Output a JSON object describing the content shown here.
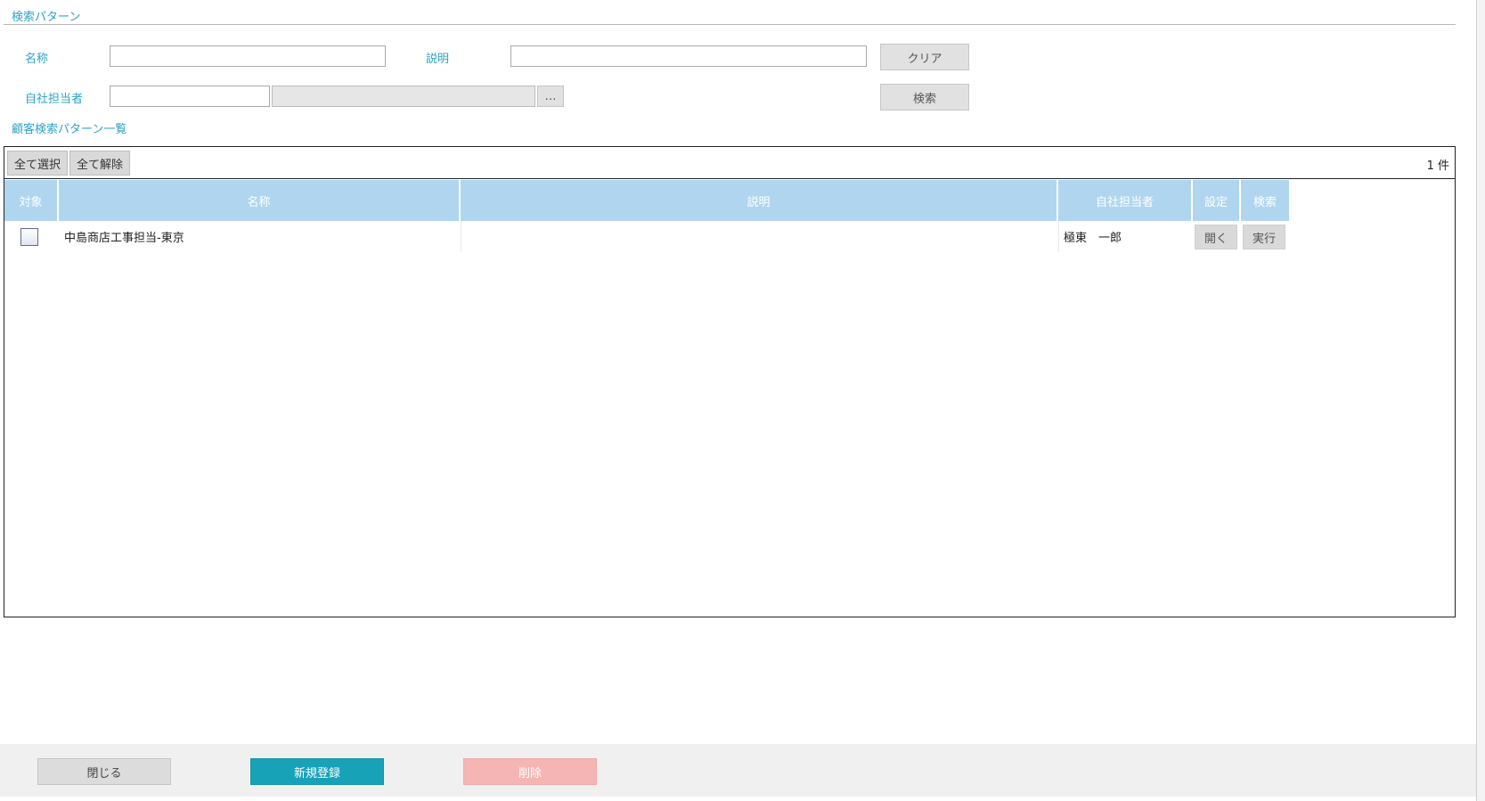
{
  "search_section": {
    "title": "検索パターン",
    "name_label": "名称",
    "name_value": "",
    "description_label": "説明",
    "description_value": "",
    "clear_button": "クリア",
    "owner_label": "自社担当者",
    "owner_code_value": "",
    "owner_name_value": "",
    "owner_picker_button": "…",
    "search_button": "検索"
  },
  "list_section": {
    "title": "顧客検索パターン一覧",
    "select_all_button": "全て選択",
    "deselect_all_button": "全て解除",
    "count_text": "1 件",
    "columns": [
      "対象",
      "名称",
      "説明",
      "自社担当者",
      "設定",
      "検索"
    ],
    "rows": [
      {
        "checked": false,
        "name": "中島商店工事担当-東京",
        "description": "",
        "owner": "極東　一郎",
        "open_button": "開く",
        "run_button": "実行"
      }
    ]
  },
  "footer": {
    "close_button": "閉じる",
    "new_button": "新規登録",
    "delete_button": "削除"
  },
  "colors": {
    "accent_text": "#2ea1c7",
    "header_bg": "#b0d6ef",
    "primary_button": "#17a2b8",
    "danger_button_disabled": "#f5b5b5"
  }
}
